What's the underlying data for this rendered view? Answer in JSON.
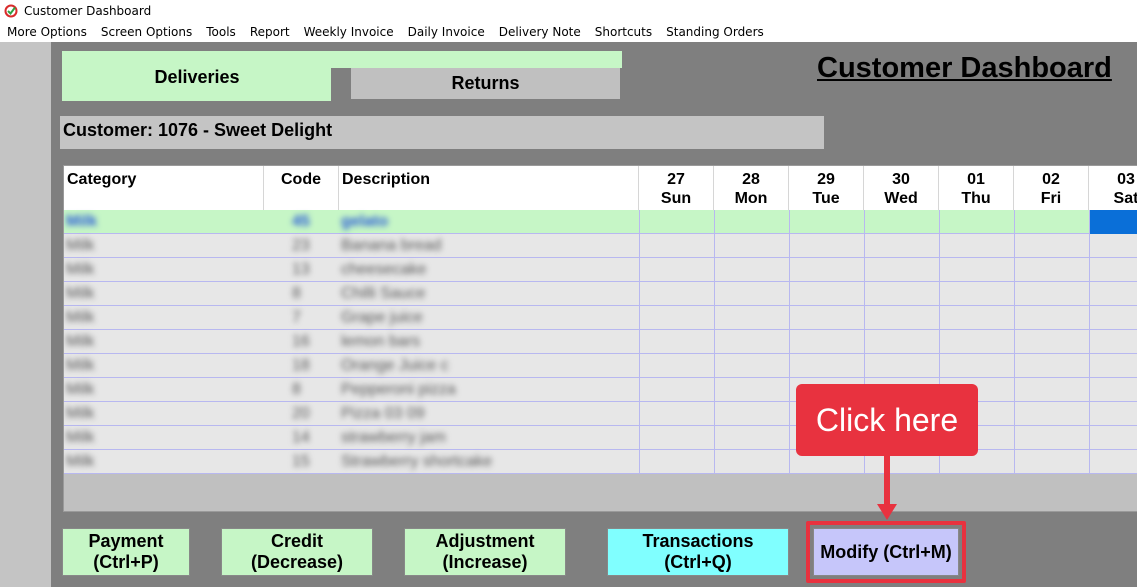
{
  "window": {
    "title": "Customer Dashboard"
  },
  "menu": [
    "More Options",
    "Screen Options",
    "Tools",
    "Report",
    "Weekly Invoice",
    "Daily Invoice",
    "Delivery Note",
    "Shortcuts",
    "Standing Orders"
  ],
  "tabs": {
    "deliveries": "Deliveries",
    "returns": "Returns"
  },
  "dashboard_title": "Customer Dashboard",
  "customer": "Customer: 1076 - Sweet Delight",
  "grid": {
    "headers": {
      "category": "Category",
      "code": "Code",
      "description": "Description"
    },
    "days": [
      {
        "date": "27",
        "day": "Sun"
      },
      {
        "date": "28",
        "day": "Mon"
      },
      {
        "date": "29",
        "day": "Tue"
      },
      {
        "date": "30",
        "day": "Wed"
      },
      {
        "date": "01",
        "day": "Thu"
      },
      {
        "date": "02",
        "day": "Fri"
      },
      {
        "date": "03",
        "day": "Sat"
      }
    ],
    "rows": [
      {
        "category": "Milk",
        "code": "45",
        "description": "gelato"
      },
      {
        "category": "Milk",
        "code": "23",
        "description": "Banana bread"
      },
      {
        "category": "Milk",
        "code": "13",
        "description": "cheesecake"
      },
      {
        "category": "Milk",
        "code": "8",
        "description": "Chilli Sauce"
      },
      {
        "category": "Milk",
        "code": "7",
        "description": "Grape juice"
      },
      {
        "category": "Milk",
        "code": "16",
        "description": "lemon bars"
      },
      {
        "category": "Milk",
        "code": "18",
        "description": "Orange Juice c"
      },
      {
        "category": "Milk",
        "code": "8",
        "description": "Pepperoni pizza"
      },
      {
        "category": "Milk",
        "code": "20",
        "description": "Pizza 03 09"
      },
      {
        "category": "Milk",
        "code": "14",
        "description": "strawberry jam"
      },
      {
        "category": "Milk",
        "code": "15",
        "description": "Strawberry shortcake"
      }
    ]
  },
  "buttons": {
    "payment": {
      "line1": "Payment",
      "line2": "(Ctrl+P)"
    },
    "credit": {
      "line1": "Credit",
      "line2": "(Decrease)"
    },
    "adjustment": {
      "line1": "Adjustment",
      "line2": "(Increase)"
    },
    "transactions": {
      "line1": "Transactions",
      "line2": "(Ctrl+Q)"
    },
    "modify": {
      "label": "Modify (Ctrl+M)"
    }
  },
  "callout": "Click here",
  "colors": {
    "accent_red": "#e8323f",
    "tab_green": "#c6f6c6",
    "button_cyan": "#80ffff",
    "button_purple": "#c6c6fa",
    "selected_cell": "#0a6fd8"
  }
}
